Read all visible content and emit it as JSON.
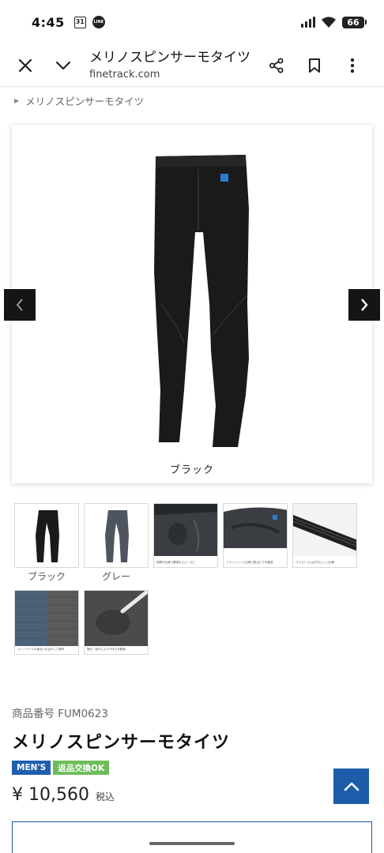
{
  "status_bar": {
    "time": "4:45",
    "calendar_day": "31",
    "line_label": "LINE",
    "battery": "66"
  },
  "browser": {
    "title": "メリノスピンサーモタイツ",
    "url": "finetrack.com"
  },
  "breadcrumb": {
    "current": "メリノスピンサーモタイツ"
  },
  "gallery": {
    "main_caption": "ブラック",
    "thumbnails": [
      {
        "label": "ブラック",
        "kind": "black-tights"
      },
      {
        "label": "グレー",
        "kind": "grey-tights"
      },
      {
        "label": "",
        "kind": "front-detail",
        "fine_print": "前開き仕様で着脱をスムーズに"
      },
      {
        "label": "",
        "kind": "waist-detail",
        "fine_print": "フラットシーム仕様で肌当たりを軽減"
      },
      {
        "label": "",
        "kind": "waistband",
        "fine_print": "ウエストゴムはずれにくい仕様"
      },
      {
        "label": "",
        "kind": "fabric-closeup",
        "fine_print": "メリノウールの風合いを活かした素材"
      },
      {
        "label": "",
        "kind": "fabric-water",
        "fine_print": "撥水・吸汗により汗冷えを軽減"
      }
    ]
  },
  "product": {
    "sku": "商品番号 FUM0623",
    "name": "メリノスピンサーモタイツ",
    "badge_mens": "MEN'S",
    "badge_return": "返品交換OK",
    "price": "¥ 10,560",
    "tax_label": "税込"
  },
  "colors": {
    "accent_blue": "#1d5ca8",
    "badge_green": "#6cbd59",
    "badge_blue": "#1f5fb0"
  }
}
